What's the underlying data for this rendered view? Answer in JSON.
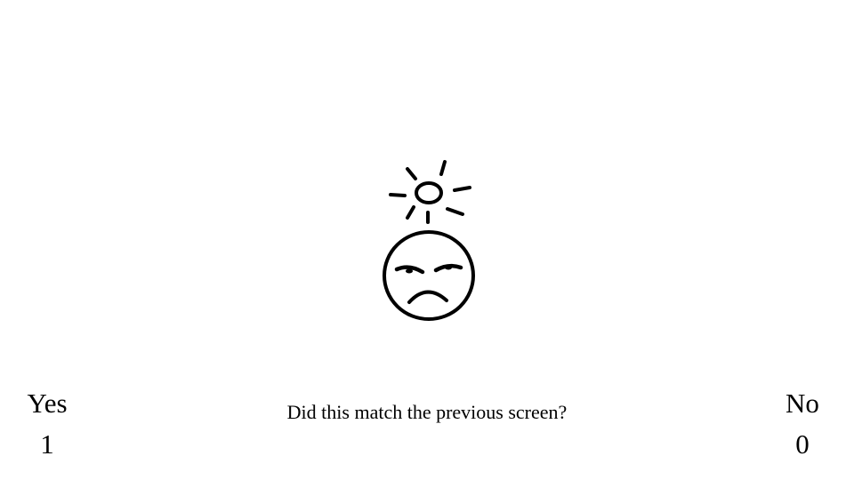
{
  "stimulus": {
    "sun_icon": "sun-icon",
    "face_icon": "frowning-face-icon",
    "stroke_color": "#000000"
  },
  "prompt": {
    "text": "Did this match the previous screen?"
  },
  "choices": {
    "yes": {
      "label": "Yes",
      "key": "1"
    },
    "no": {
      "label": "No",
      "key": "0"
    }
  }
}
